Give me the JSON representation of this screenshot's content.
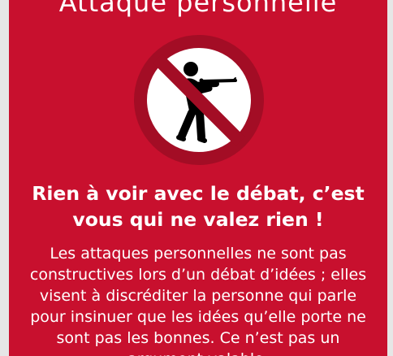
{
  "card": {
    "title": "Attaque personnelle",
    "subtitle_lines": [
      "Rien à voir avec le débat, c’est",
      "vous qui ne valez rien !"
    ],
    "body_lines": [
      "Les attaques personnelles ne sont pas",
      "constructives lors d’un débat d’idées ; elles",
      "visent à discréditer la personne qui parle",
      "pour insinuer que les idées qu’elle porte ne",
      "sont pas les bonnes. Ce n’est pas un",
      "argument valable."
    ]
  },
  "colors": {
    "background": "#c8102e",
    "sign_ring": "#a30d25",
    "text": "#ffffff",
    "figure": "#000000"
  },
  "icons": {
    "sign": "no-shooting-prohibition-icon"
  }
}
